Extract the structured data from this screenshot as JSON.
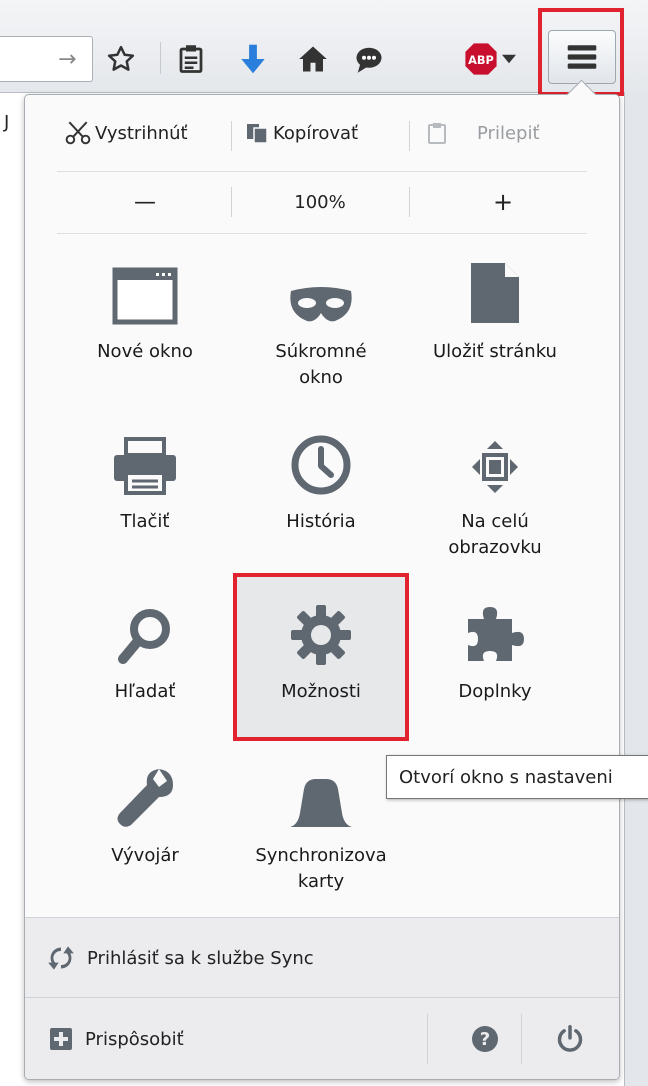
{
  "toolbar": {
    "url_arrow": "→",
    "icons": [
      "star-icon",
      "reading-list-icon",
      "download-icon",
      "home-icon",
      "chat-icon",
      "adblock-icon",
      "hamburger-menu-icon"
    ],
    "abp_label": "ABP"
  },
  "left_mark": "J",
  "edit": {
    "cut": "Vystrihnúť",
    "copy": "Kopírovať",
    "paste": "Prilepiť"
  },
  "zoom": {
    "minus": "—",
    "level": "100%",
    "plus": "+"
  },
  "grid": [
    {
      "label": "Nové okno",
      "icon": "new-window-icon"
    },
    {
      "label": "Súkromné okno",
      "icon": "private-window-mask-icon"
    },
    {
      "label": "Uložiť stránku",
      "icon": "save-page-icon"
    },
    {
      "label": "Tlačiť",
      "icon": "print-icon"
    },
    {
      "label": "História",
      "icon": "history-clock-icon"
    },
    {
      "label": "Na celú obrazovku",
      "icon": "fullscreen-icon"
    },
    {
      "label": "Hľadať",
      "icon": "search-icon"
    },
    {
      "label": "Možnosti",
      "icon": "gear-icon"
    },
    {
      "label": "Doplnky",
      "icon": "puzzle-icon"
    },
    {
      "label": "Vývojár",
      "icon": "wrench-icon"
    },
    {
      "label": "Synchronizovať karty",
      "icon": "sync-tabs-icon"
    }
  ],
  "grid_labels_display": {
    "new_window": "Nové okno",
    "private_l1": "Súkromné",
    "private_l2": "okno",
    "save_page": "Uložiť stránku",
    "print": "Tlačiť",
    "history": "História",
    "fullscreen_l1": "Na celú",
    "fullscreen_l2": "obrazovku",
    "search": "Hľadať",
    "options": "Možnosti",
    "addons": "Doplnky",
    "developer": "Vývojár",
    "sync_l1": "Synchronizova",
    "sync_l2": "karty"
  },
  "tooltip": "Otvorí okno s nastaveni",
  "footer": {
    "sync": "Prihlásiť sa k službe Sync",
    "customize": "Prispôsobiť",
    "help_glyph": "?",
    "quit_icon": "power-icon"
  },
  "colors": {
    "highlight_red": "#e0232e",
    "icon_gray": "#5f6770",
    "download_blue": "#2a7fdc",
    "abp_red": "#c8102e"
  }
}
